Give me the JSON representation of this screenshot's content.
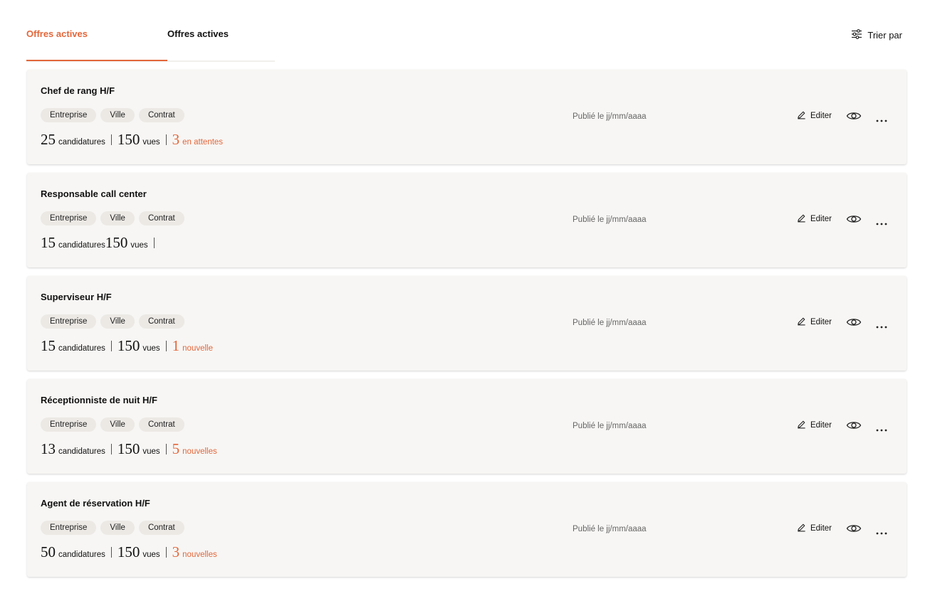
{
  "tabs": [
    {
      "label": "Offres actives",
      "active": true
    },
    {
      "label": "Offres actives",
      "active": false
    }
  ],
  "sort": {
    "label": "Trier par",
    "icon": "sliders-icon"
  },
  "colors": {
    "accent": "#e3673b",
    "card_bg": "#f7f6f4",
    "tag_bg": "#ece9e5"
  },
  "jobs": [
    {
      "title": "Chef de rang H/F",
      "tags": [
        "Entreprise",
        "Ville",
        "Contrat"
      ],
      "candidatures": "25",
      "candidatures_label": "candidatures",
      "vues": "150",
      "vues_label": "vues",
      "extra_num": "3",
      "extra_label": "en attentes",
      "published": "Publié le jj/mm/aaaa",
      "edit_label": "Editer"
    },
    {
      "title": "Responsable call center",
      "tags": [
        "Entreprise",
        "Ville",
        "Contrat"
      ],
      "candidatures": "15",
      "candidatures_label": "candidatures",
      "vues": "150",
      "vues_label": "vues",
      "extra_num": "",
      "extra_label": "",
      "published": "Publié le jj/mm/aaaa",
      "edit_label": "Editer"
    },
    {
      "title": "Superviseur H/F",
      "tags": [
        "Entreprise",
        "Ville",
        "Contrat"
      ],
      "candidatures": "15",
      "candidatures_label": "candidatures",
      "vues": "150",
      "vues_label": "vues",
      "extra_num": "1",
      "extra_label": "nouvelle",
      "published": "Publié le jj/mm/aaaa",
      "edit_label": "Editer"
    },
    {
      "title": "Réceptionniste de nuit H/F",
      "tags": [
        "Entreprise",
        "Ville",
        "Contrat"
      ],
      "candidatures": "13",
      "candidatures_label": "candidatures",
      "vues": "150",
      "vues_label": "vues",
      "extra_num": "5",
      "extra_label": "nouvelles",
      "published": "Publié le jj/mm/aaaa",
      "edit_label": "Editer"
    },
    {
      "title": "Agent de réservation H/F",
      "tags": [
        "Entreprise",
        "Ville",
        "Contrat"
      ],
      "candidatures": "50",
      "candidatures_label": "candidatures",
      "vues": "150",
      "vues_label": "vues",
      "extra_num": "3",
      "extra_label": "nouvelles",
      "published": "Publié le jj/mm/aaaa",
      "edit_label": "Editer"
    }
  ]
}
